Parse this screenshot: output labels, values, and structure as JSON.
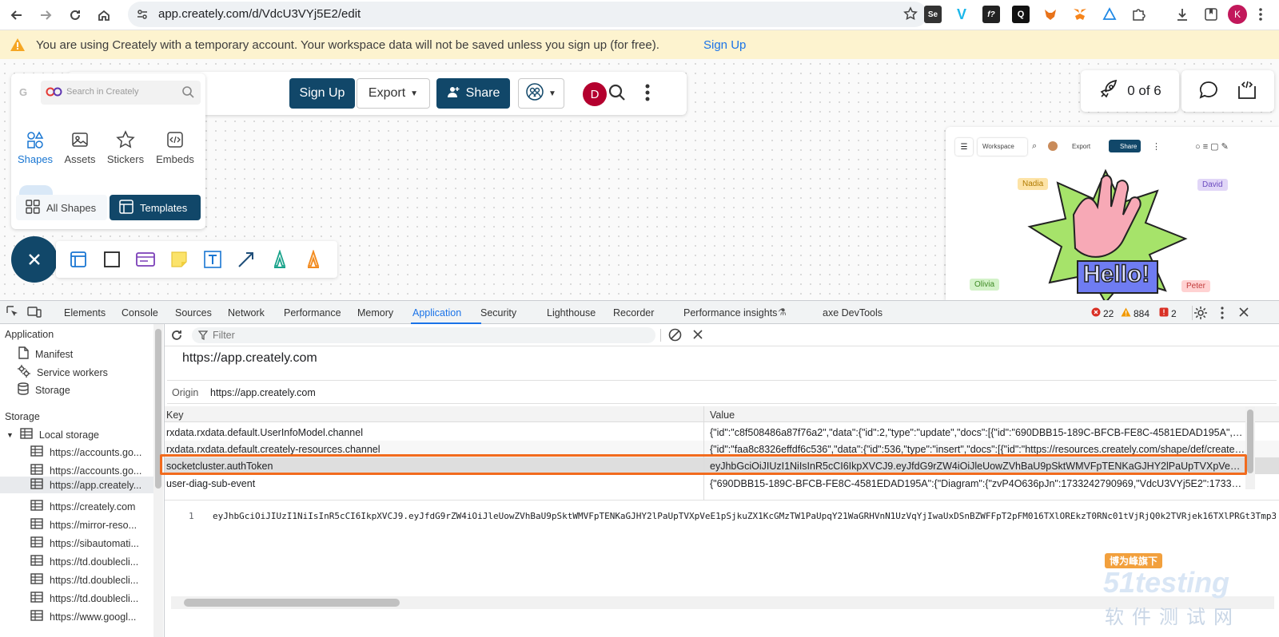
{
  "browser": {
    "url": "app.creately.com/d/VdcU3VYj5E2/edit",
    "profile_initial": "K",
    "extensions": [
      "Se",
      "V",
      "f?",
      "Q",
      "fox",
      "fox2",
      "tri",
      "puzzle"
    ]
  },
  "banner": {
    "message": "You are using Creately with a temporary account. Your workspace data will not be saved unless you sign up (for free).",
    "link": "Sign Up"
  },
  "toolbar": {
    "sign_up": "Sign Up",
    "export": "Export",
    "share": "Share",
    "avatar": "D"
  },
  "panel": {
    "search_placeholder": "Search in Creately",
    "tabs": [
      "Shapes",
      "Assets",
      "Stickers",
      "Embeds"
    ],
    "all_shapes": "All Shapes",
    "templates": "Templates"
  },
  "progress": {
    "label": "0 of 6"
  },
  "preview": {
    "workspace": "Workspace",
    "export": "Export",
    "share": "Share",
    "cursors": [
      "Nadia",
      "David",
      "Olivia",
      "Peter"
    ],
    "hello": "Hello!"
  },
  "devtools": {
    "tabs": [
      "Elements",
      "Console",
      "Sources",
      "Network",
      "Performance",
      "Memory",
      "Application",
      "Security",
      "Lighthouse",
      "Recorder",
      "Performance insights",
      "axe DevTools"
    ],
    "errors": "22",
    "warnings": "884",
    "issues": "2",
    "sidebar": {
      "application_header": "Application",
      "application_items": [
        "Manifest",
        "Service workers",
        "Storage"
      ],
      "storage_header": "Storage",
      "local_storage": "Local storage",
      "local_items": [
        "https://accounts.go...",
        "https://accounts.go...",
        "https://app.creately...",
        "https://creately.com",
        "https://mirror-reso...",
        "https://sibautomati...",
        "https://td.doublecli...",
        "https://td.doublecli...",
        "https://td.doublecli...",
        "https://www.googl..."
      ]
    },
    "filter_placeholder": "Filter",
    "origin_title": "https://app.creately.com",
    "origin_label": "Origin",
    "origin_value": "https://app.creately.com",
    "columns": [
      "Key",
      "Value"
    ],
    "rows": [
      {
        "key": "rxdata.rxdata.default.UserInfoModel.channel",
        "value": "{\"id\":\"c8f508486a87f76a2\",\"data\":{\"id\":2,\"type\":\"update\",\"docs\":[{\"id\":\"690DBB15-189C-BFCB-FE8C-4581EDAD195A\",\"first..."
      },
      {
        "key": "rxdata.rxdata.default.creately-resources.channel",
        "value": "{\"id\":\"faa8c8326effdf6c536\",\"data\":{\"id\":536,\"type\":\"insert\",\"docs\":[{\"id\":\"https://resources.creately.com/shape/def/creately...."
      },
      {
        "key": "socketcluster.authToken",
        "value": "eyJhbGciOiJIUzI1NiIsInR5cCI6IkpXVCJ9.eyJfdG9rZW4iOiJleUowZVhBaU9pSktWMVFpTENKaGJHY2lPaUpTVXpVeE1pSjkuZX..."
      },
      {
        "key": "user-diag-sub-event",
        "value": "{\"690DBB15-189C-BFCB-FE8C-4581EDAD195A\":{\"Diagram\":{\"zvP4O636pJn\":1733242790969,\"VdcU3VYj5E2\":17332427986..."
      }
    ],
    "line_number": "1",
    "token_full": "eyJhbGciOiJIUzI1NiIsInR5cCI6IkpXVCJ9.eyJfdG9rZW4iOiJleUowZVhBaU9pSktWMVFpTENKaGJHY2lPaUpTVXpVeE1pSjkuZX1KcGMzTW1PaUpqY21WaGRHVnN1UzVqYjIwaUxDSnBZWFFpT2pFM016TXlOREkzT0RNc01tVjRjQ0k2TVRjek16TXlPRGt3Tmp3c0luUjFaVE"
  },
  "watermark": {
    "tag": "博为峰旗下",
    "logo": "51testing",
    "cn": "软件测试网"
  }
}
